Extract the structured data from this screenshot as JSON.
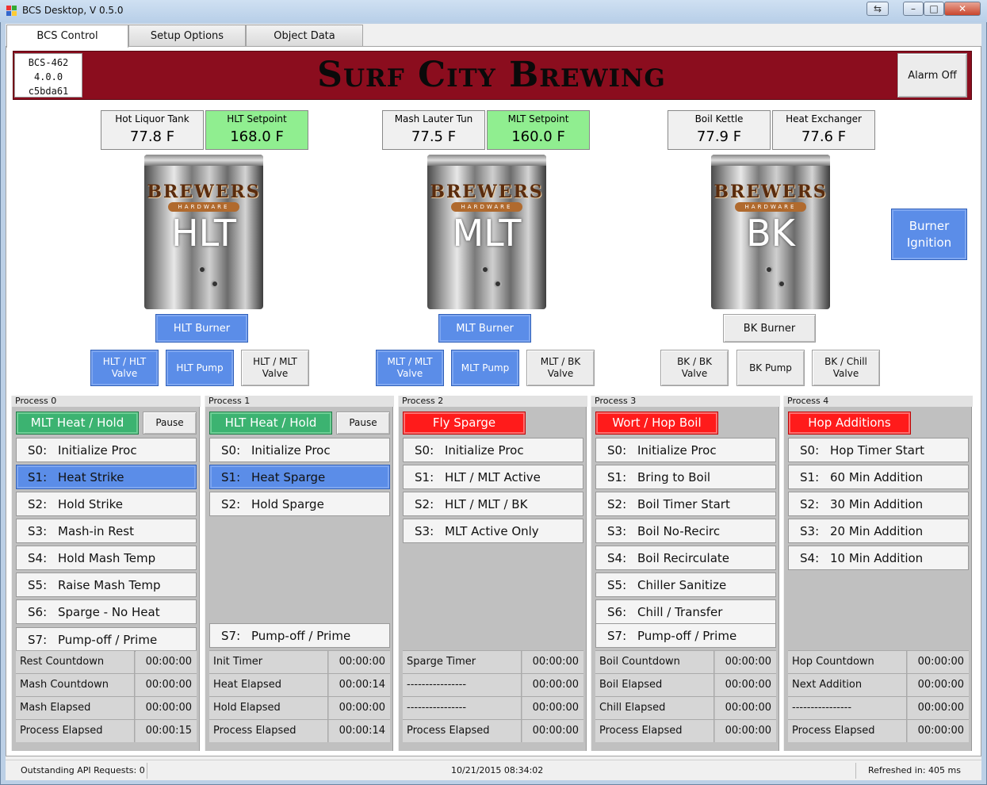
{
  "window": {
    "title": "BCS Desktop, V 0.5.0",
    "btn_restore": "⇆",
    "btn_min": "–",
    "btn_max": "□",
    "btn_close": "✕"
  },
  "tabs": [
    {
      "label": "BCS Control"
    },
    {
      "label": "Setup Options"
    },
    {
      "label": "Object Data"
    }
  ],
  "device": {
    "model": "BCS-462",
    "firmware": "4.0.0",
    "id": "c5bda61"
  },
  "banner": {
    "title": "Surf City Brewing"
  },
  "alarm_label": "Alarm Off",
  "burner_ignition_label": "Burner Ignition",
  "vessel_brand": {
    "top": "BREWERS",
    "bottom": "HARDWARE"
  },
  "vessels": [
    {
      "name": "HLT",
      "t1": {
        "label": "Hot Liquor Tank",
        "value": "77.8 F"
      },
      "t2": {
        "label": "HLT Setpoint",
        "value": "168.0 F"
      },
      "burner": "HLT Burner",
      "outs": [
        "HLT / HLT Valve",
        "HLT Pump",
        "HLT / MLT Valve"
      ]
    },
    {
      "name": "MLT",
      "t1": {
        "label": "Mash Lauter Tun",
        "value": "77.5 F"
      },
      "t2": {
        "label": "MLT Setpoint",
        "value": "160.0 F"
      },
      "burner": "MLT Burner",
      "outs": [
        "MLT / MLT Valve",
        "MLT Pump",
        "MLT / BK Valve"
      ]
    },
    {
      "name": "BK",
      "t1": {
        "label": "Boil Kettle",
        "value": "77.9 F"
      },
      "t2": {
        "label": "Heat Exchanger",
        "value": "77.6 F"
      },
      "burner": "BK Burner",
      "outs": [
        "BK / BK Valve",
        "BK Pump",
        "BK / Chill Valve"
      ]
    }
  ],
  "colors": {
    "active_blue": "#5b8de8",
    "green": "#3cb371",
    "red": "#ff1b1b",
    "setpoint_green": "#90ee90",
    "banner": "#8b0d1e"
  },
  "processes": [
    {
      "header": "Process 0",
      "state": "MLT Heat / Hold",
      "state_color": "green",
      "pause": "Pause",
      "steps": [
        {
          "n": "S0:",
          "name": "Initialize Proc"
        },
        {
          "n": "S1:",
          "name": "Heat Strike",
          "active": true
        },
        {
          "n": "S2:",
          "name": "Hold Strike"
        },
        {
          "n": "S3:",
          "name": "Mash-in Rest"
        },
        {
          "n": "S4:",
          "name": "Hold Mash Temp"
        },
        {
          "n": "S5:",
          "name": "Raise Mash Temp"
        },
        {
          "n": "S6:",
          "name": "Sparge - No Heat"
        },
        {
          "n": "S7:",
          "name": "Pump-off / Prime"
        }
      ],
      "timers": [
        {
          "label": "Rest Countdown",
          "value": "00:00:00"
        },
        {
          "label": "Mash Countdown",
          "value": "00:00:00"
        },
        {
          "label": "Mash Elapsed",
          "value": "00:00:00"
        },
        {
          "label": "Process Elapsed",
          "value": "00:00:15"
        }
      ]
    },
    {
      "header": "Process 1",
      "state": "HLT Heat / Hold",
      "state_color": "green",
      "pause": "Pause",
      "steps": [
        {
          "n": "S0:",
          "name": "Initialize Proc"
        },
        {
          "n": "S1:",
          "name": "Heat Sparge",
          "active": true
        },
        {
          "n": "S2:",
          "name": "Hold Sparge"
        },
        null,
        null,
        null,
        null,
        {
          "n": "S7:",
          "name": "Pump-off / Prime"
        }
      ],
      "timers": [
        {
          "label": "Init Timer",
          "value": "00:00:00"
        },
        {
          "label": "Heat Elapsed",
          "value": "00:00:14"
        },
        {
          "label": "Hold Elapsed",
          "value": "00:00:00"
        },
        {
          "label": "Process Elapsed",
          "value": "00:00:14"
        }
      ]
    },
    {
      "header": "Process 2",
      "state": "Fly Sparge",
      "state_color": "red",
      "steps": [
        {
          "n": "S0:",
          "name": "Initialize Proc"
        },
        {
          "n": "S1:",
          "name": "HLT / MLT Active"
        },
        {
          "n": "S2:",
          "name": "HLT / MLT / BK"
        },
        {
          "n": "S3:",
          "name": "MLT Active Only"
        }
      ],
      "timers": [
        {
          "label": "Sparge Timer",
          "value": "00:00:00"
        },
        {
          "label": "----------------",
          "value": "00:00:00"
        },
        {
          "label": "----------------",
          "value": "00:00:00"
        },
        {
          "label": "Process Elapsed",
          "value": "00:00:00"
        }
      ]
    },
    {
      "header": "Process 3",
      "state": "Wort / Hop Boil",
      "state_color": "red",
      "steps": [
        {
          "n": "S0:",
          "name": "Initialize Proc"
        },
        {
          "n": "S1:",
          "name": "Bring to Boil"
        },
        {
          "n": "S2:",
          "name": "Boil Timer Start"
        },
        {
          "n": "S3:",
          "name": "Boil No-Recirc"
        },
        {
          "n": "S4:",
          "name": "Boil Recirculate"
        },
        {
          "n": "S5:",
          "name": "Chiller Sanitize"
        },
        {
          "n": "S6:",
          "name": "Chill / Transfer"
        },
        {
          "n": "S7:",
          "name": "Pump-off / Prime"
        }
      ],
      "timers": [
        {
          "label": "Boil Countdown",
          "value": "00:00:00"
        },
        {
          "label": "Boil Elapsed",
          "value": "00:00:00"
        },
        {
          "label": "Chill Elapsed",
          "value": "00:00:00"
        },
        {
          "label": "Process Elapsed",
          "value": "00:00:00"
        }
      ]
    },
    {
      "header": "Process 4",
      "state": "Hop Additions",
      "state_color": "red",
      "steps": [
        {
          "n": "S0:",
          "name": "Hop Timer Start"
        },
        {
          "n": "S1:",
          "name": "60 Min Addition"
        },
        {
          "n": "S2:",
          "name": "30 Min Addition"
        },
        {
          "n": "S3:",
          "name": "20 Min Addition"
        },
        {
          "n": "S4:",
          "name": "10 Min Addition"
        }
      ],
      "timers": [
        {
          "label": "Hop Countdown",
          "value": "00:00:00"
        },
        {
          "label": "Next Addition",
          "value": "00:00:00"
        },
        {
          "label": "----------------",
          "value": "00:00:00"
        },
        {
          "label": "Process Elapsed",
          "value": "00:00:00"
        }
      ]
    }
  ],
  "statusbar": {
    "api": "Outstanding API Requests: 0",
    "datetime": "10/21/2015   08:34:02",
    "refresh": "Refreshed in: 405 ms"
  }
}
